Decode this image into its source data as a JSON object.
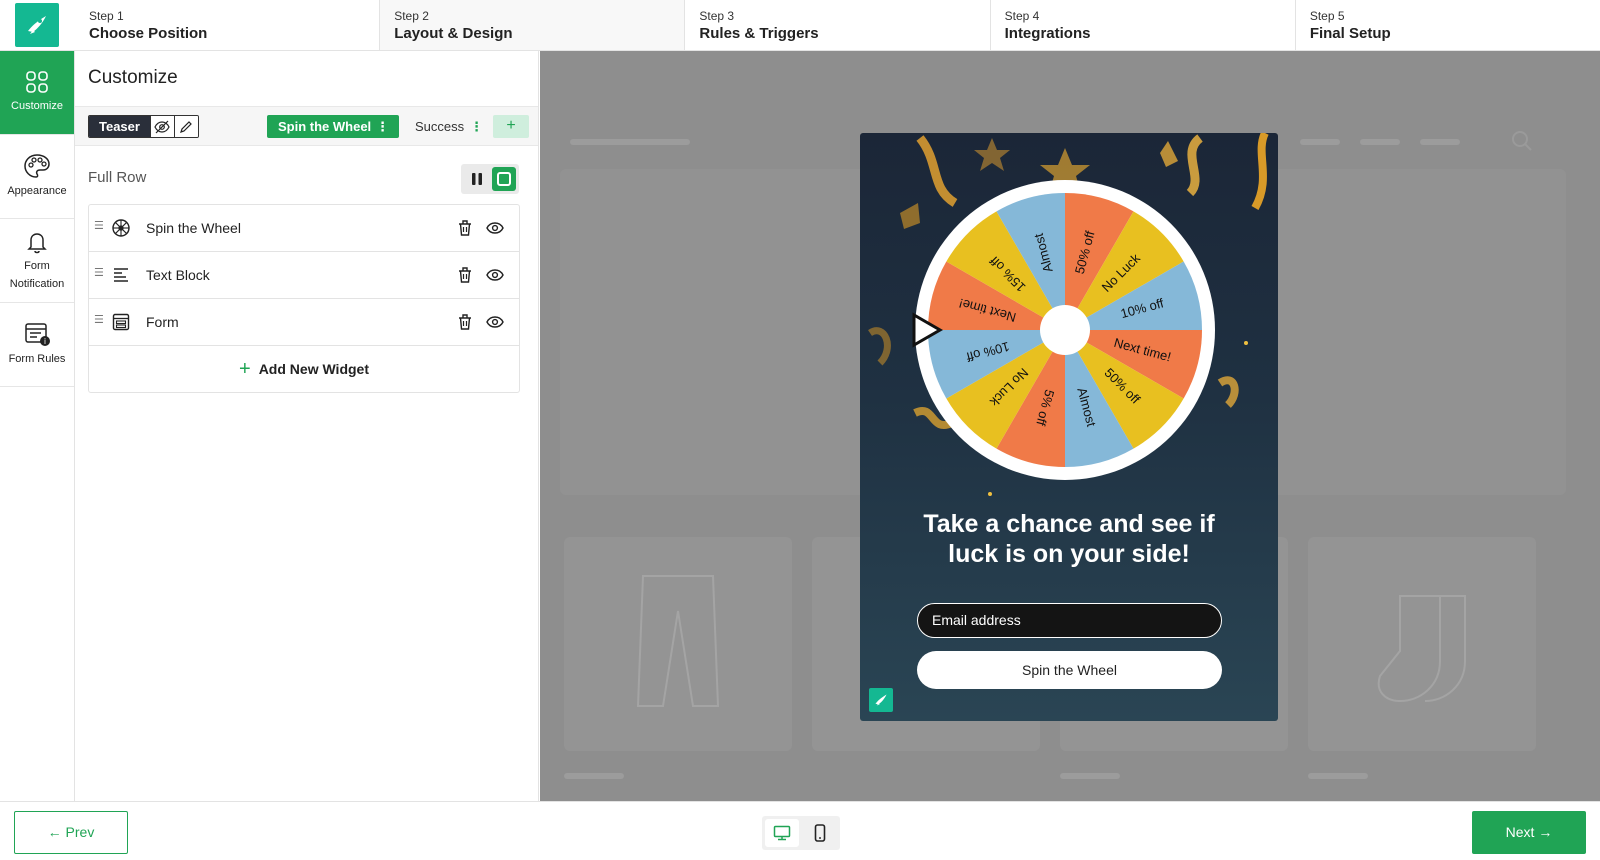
{
  "steps": [
    {
      "num": "Step 1",
      "title": "Choose Position"
    },
    {
      "num": "Step 2",
      "title": "Layout & Design"
    },
    {
      "num": "Step 3",
      "title": "Rules & Triggers"
    },
    {
      "num": "Step 4",
      "title": "Integrations"
    },
    {
      "num": "Step 5",
      "title": "Final Setup"
    }
  ],
  "rail": [
    {
      "label": "Customize",
      "icon": "grid-icon"
    },
    {
      "label": "Appearance",
      "icon": "palette-icon"
    },
    {
      "label": "Form Notification",
      "icon": "bell-icon"
    },
    {
      "label": "Form Rules",
      "icon": "form-rules-icon"
    }
  ],
  "panel": {
    "title": "Customize",
    "teaser_label": "Teaser",
    "tab_spin": "Spin the Wheel",
    "tab_success": "Success",
    "tab_add": "+",
    "tab_menu": "⋮",
    "row_label": "Full Row",
    "widgets": [
      {
        "label": "Spin the Wheel",
        "icon": "wheel-icon"
      },
      {
        "label": "Text Block",
        "icon": "text-align-icon"
      },
      {
        "label": "Form",
        "icon": "form-icon"
      }
    ],
    "add_widget": "Add New Widget"
  },
  "popup": {
    "wheel_segments": [
      "50% off",
      "No Luck",
      "10% off",
      "Next time!",
      "50% off",
      "Almost",
      "5% off",
      "No Luck",
      "10% off",
      "Next time!",
      "15% off",
      "Almost"
    ],
    "headline_line1": "Take a chance and see if",
    "headline_line2": "luck is on your side!",
    "email_placeholder": "Email address",
    "button": "Spin the Wheel"
  },
  "footer": {
    "prev": "← Prev",
    "next": "Next →"
  },
  "colors": {
    "brand_green": "#20a455",
    "logo_teal": "#14b892",
    "wheel_orange": "#f07a48",
    "wheel_yellow": "#e8c020",
    "wheel_blue": "#85b8d8"
  }
}
